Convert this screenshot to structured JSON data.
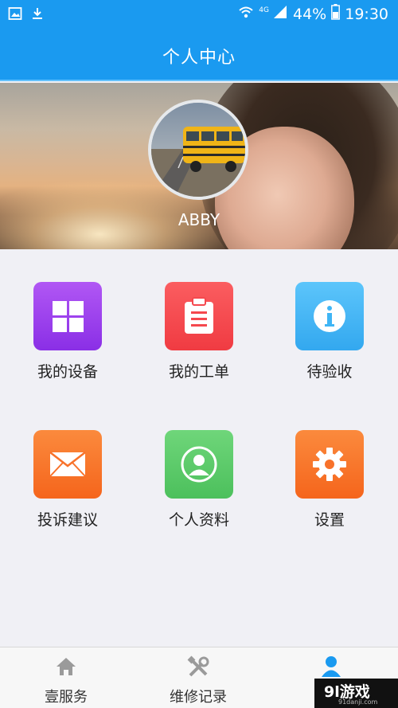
{
  "status_bar": {
    "network": "4G",
    "battery": "44%",
    "time": "19:30",
    "left_icons": [
      "image-icon",
      "download-icon"
    ],
    "right_icons": [
      "wifi-icon",
      "signal-icon",
      "battery-icon"
    ]
  },
  "header": {
    "title": "个人中心"
  },
  "profile": {
    "username": "ABBY"
  },
  "menu": [
    {
      "label": "我的设备",
      "icon": "grid-icon",
      "color": "#9b3df0"
    },
    {
      "label": "我的工单",
      "icon": "clipboard-icon",
      "color": "#f5484e"
    },
    {
      "label": "待验收",
      "icon": "info-icon",
      "color": "#3fb5f5"
    },
    {
      "label": "投诉建议",
      "icon": "envelope-icon",
      "color": "#f8722a"
    },
    {
      "label": "个人资料",
      "icon": "person-icon",
      "color": "#5dcc6a"
    },
    {
      "label": "设置",
      "icon": "gear-icon",
      "color": "#f8722a"
    }
  ],
  "bottom_nav": [
    {
      "label": "壹服务",
      "icon": "home-icon"
    },
    {
      "label": "维修记录",
      "icon": "tools-icon"
    },
    {
      "label": "",
      "icon": "user-icon",
      "active": true
    }
  ],
  "colors": {
    "primary": "#1a9af0",
    "nav_active": "#1a9af0",
    "nav_inactive": "#9a9a9a"
  },
  "watermark": {
    "main": "9l游戏",
    "sub": "91danji.com"
  }
}
